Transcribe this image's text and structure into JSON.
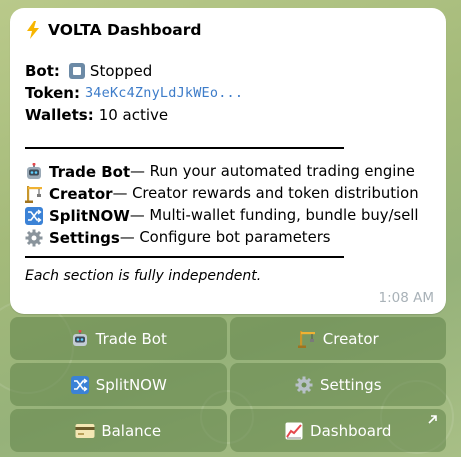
{
  "message": {
    "title": "VOLTA Dashboard",
    "title_icon": "lightning-icon",
    "status": {
      "bot_label": "Bot:",
      "bot_value": "Stopped",
      "bot_icon": "stop-icon",
      "token_label": "Token:",
      "token_value": "34eKc4ZnyLdJkWEo...",
      "wallets_label": "Wallets:",
      "wallets_value": "10 active"
    },
    "sections": [
      {
        "icon": "robot-icon",
        "name": "Trade Bot",
        "desc": " — Run your automated trading engine"
      },
      {
        "icon": "construction-icon",
        "name": "Creator",
        "desc": " — Creator rewards and token distribution"
      },
      {
        "icon": "shuffle-icon",
        "name": "SplitNOW",
        "desc": " — Multi-wallet funding, bundle buy/sell"
      },
      {
        "icon": "gear-icon",
        "name": "Settings",
        "desc": " — Configure bot parameters"
      }
    ],
    "footer": "Each section is fully independent.",
    "time": "1:08 AM"
  },
  "keyboard": {
    "rows": [
      [
        {
          "label": "Trade Bot",
          "icon": "robot-icon"
        },
        {
          "label": "Creator",
          "icon": "construction-icon"
        }
      ],
      [
        {
          "label": "SplitNOW",
          "icon": "shuffle-icon"
        },
        {
          "label": "Settings",
          "icon": "gear-icon"
        }
      ],
      [
        {
          "label": "Balance",
          "icon": "card-icon"
        },
        {
          "label": "Dashboard",
          "icon": "chart-icon",
          "external": true
        }
      ]
    ]
  },
  "colors": {
    "background": "#a4ba7a",
    "bubble": "#ffffff",
    "token_link": "#3d7cc9",
    "keyboard_button": "#6f8f57",
    "timestamp": "#a9b2b8"
  }
}
